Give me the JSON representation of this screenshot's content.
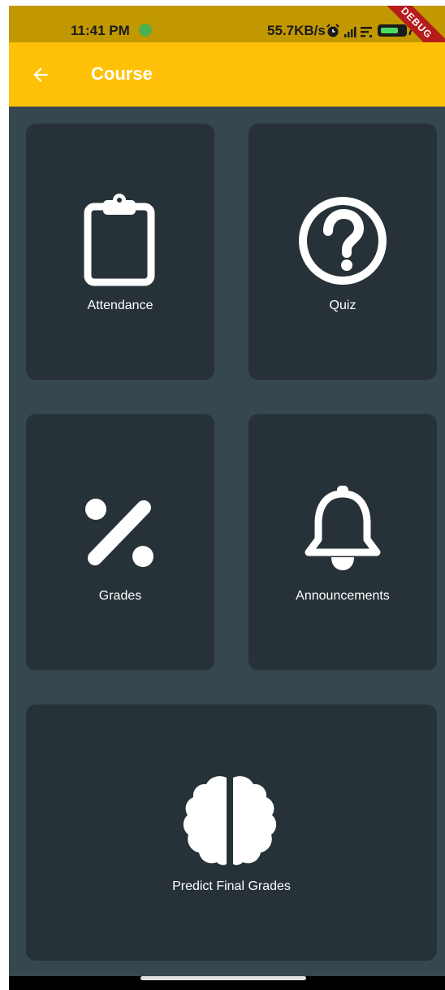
{
  "status_bar": {
    "time": "11:41 PM",
    "network_speed": "55.7KB/s",
    "battery_percent": "76",
    "battery_level": 0.76
  },
  "debug_banner": "DEBUG",
  "app_bar": {
    "title": "Course",
    "back_icon": "arrow-back-icon",
    "color": "#ffc107"
  },
  "cards": [
    {
      "label": "Attendance",
      "icon": "clipboard-icon"
    },
    {
      "label": "Quiz",
      "icon": "help-circle-icon"
    },
    {
      "label": "Grades",
      "icon": "percent-icon"
    },
    {
      "label": "Announcements",
      "icon": "bell-icon"
    },
    {
      "label": "Predict Final Grades",
      "icon": "brain-icon"
    }
  ],
  "colors": {
    "background": "#37474f",
    "card": "#263238",
    "accent": "#ffc107",
    "text": "#ffffff"
  }
}
